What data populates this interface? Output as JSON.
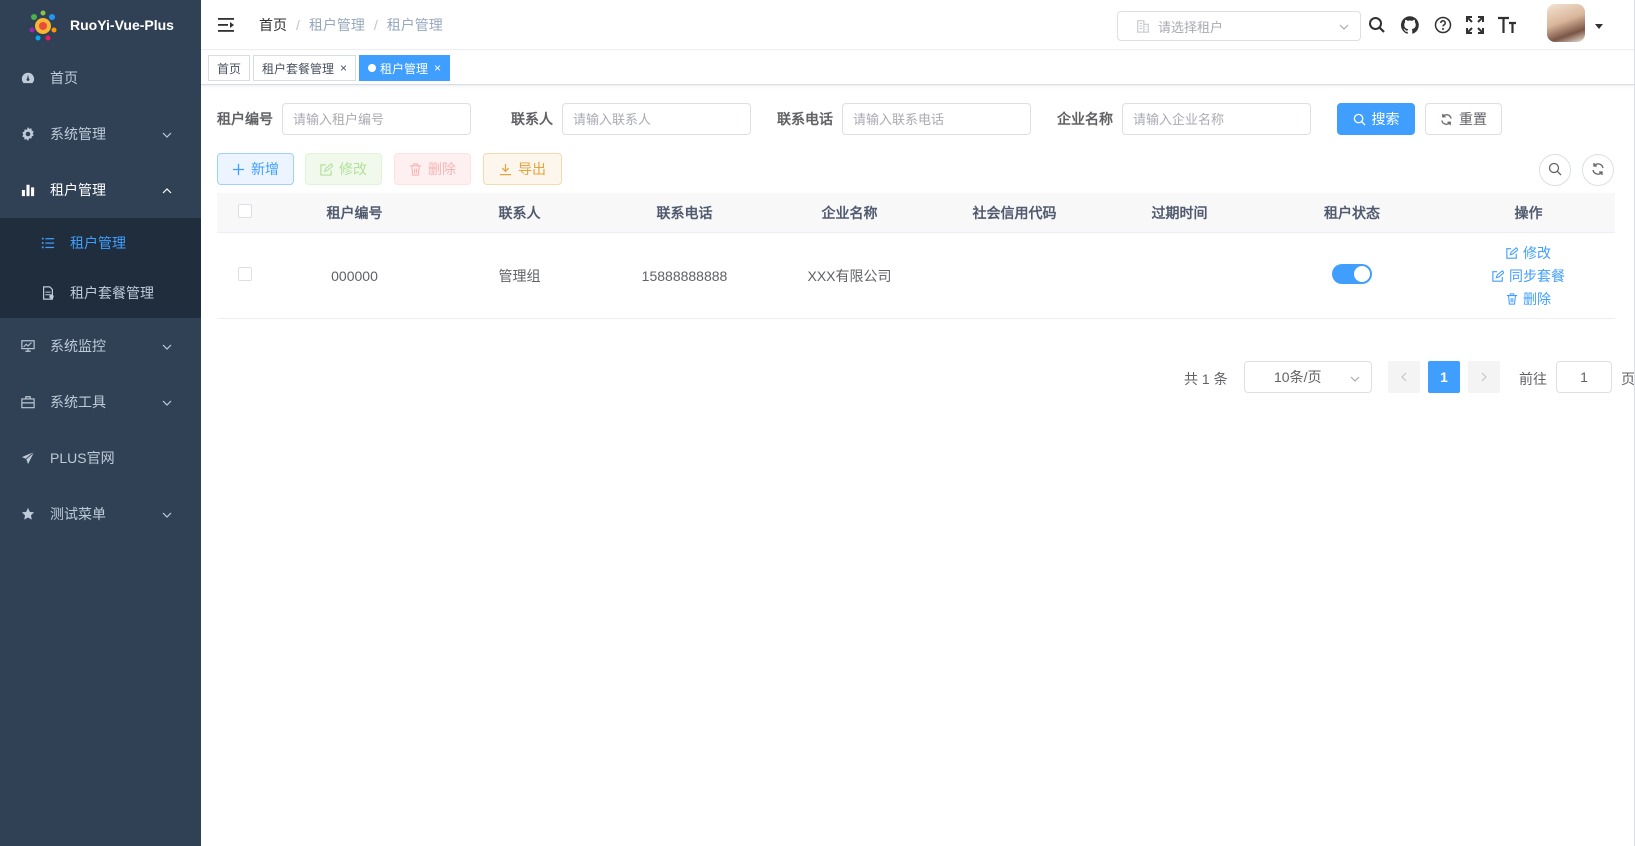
{
  "app": {
    "title": "RuoYi-Vue-Plus"
  },
  "sidebar": {
    "items": [
      {
        "label": "首页",
        "icon": "dashboard-icon"
      },
      {
        "label": "系统管理",
        "icon": "gear-icon"
      },
      {
        "label": "租户管理",
        "icon": "bar-chart-icon"
      },
      {
        "label": "系统监控",
        "icon": "monitor-icon"
      },
      {
        "label": "系统工具",
        "icon": "toolbox-icon"
      },
      {
        "label": "PLUS官网",
        "icon": "paper-plane-icon"
      },
      {
        "label": "测试菜单",
        "icon": "star-icon"
      }
    ],
    "subitems": [
      {
        "label": "租户管理",
        "icon": "list-icon",
        "active": true
      },
      {
        "label": "租户套餐管理",
        "icon": "document-icon",
        "active": false
      }
    ]
  },
  "navbar": {
    "breadcrumb": [
      "首页",
      "租户管理",
      "租户管理"
    ],
    "breadcrumb_sep": "/",
    "tenant_placeholder": "请选择租户"
  },
  "tags": [
    {
      "label": "首页"
    },
    {
      "label": "租户套餐管理",
      "close": "×"
    },
    {
      "label": "租户管理",
      "close": "×",
      "active": true
    }
  ],
  "search": {
    "fields": [
      {
        "label": "租户编号",
        "placeholder": "请输入租户编号"
      },
      {
        "label": "联系人",
        "placeholder": "请输入联系人"
      },
      {
        "label": "联系电话",
        "placeholder": "请输入联系电话"
      },
      {
        "label": "企业名称",
        "placeholder": "请输入企业名称"
      }
    ],
    "search_label": "搜索",
    "reset_label": "重置"
  },
  "toolbar": {
    "add_label": "新增",
    "edit_label": "修改",
    "delete_label": "删除",
    "export_label": "导出"
  },
  "table": {
    "columns": [
      "租户编号",
      "联系人",
      "联系电话",
      "企业名称",
      "社会信用代码",
      "过期时间",
      "租户状态",
      "操作"
    ],
    "rows": [
      {
        "tenant_id": "000000",
        "contact": "管理组",
        "phone": "15888888888",
        "company": "XXX有限公司",
        "credit_code": "",
        "expire": "",
        "status_on": true,
        "actions": [
          "修改",
          "同步套餐",
          "删除"
        ]
      }
    ]
  },
  "pagination": {
    "total_text": "共 1 条",
    "page_size": "10条/页",
    "current_page": "1",
    "goto_label": "前往",
    "goto_value": "1",
    "page_unit": "页"
  },
  "colors": {
    "sidebar_bg": "#304156",
    "submenu_bg": "#1f2d3d",
    "primary": "#409eff"
  }
}
